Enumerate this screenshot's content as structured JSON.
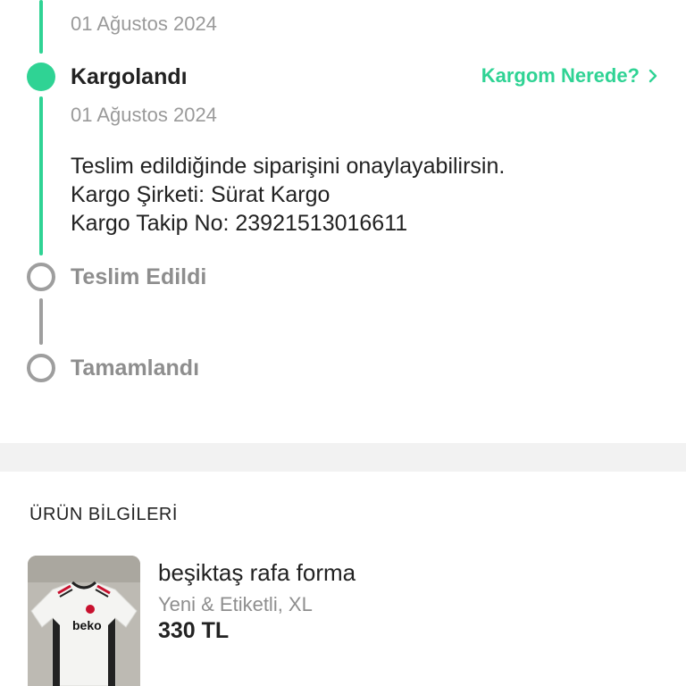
{
  "timeline": {
    "previous_date": "01 Ağustos 2024",
    "steps": [
      {
        "title": "Kargolandı",
        "date": "01 Ağustos 2024",
        "status": "completed",
        "link_label": "Kargom Nerede?",
        "details": [
          "Teslim edildiğinde siparişini onaylayabilirsin.",
          "Kargo Şirketi: Sürat Kargo",
          "Kargo Takip No: 23921513016611"
        ]
      },
      {
        "title": "Teslim Edildi",
        "status": "pending"
      },
      {
        "title": "Tamamlandı",
        "status": "pending"
      }
    ],
    "colors": {
      "active": "#2fd394",
      "inactive": "#9e9e9e"
    }
  },
  "product_section": {
    "title": "ÜRÜN BİLGİLERİ",
    "product": {
      "name": "beşiktaş rafa forma",
      "condition": "Yeni & Etiketli, XL",
      "price": "330 TL",
      "jersey_sponsor": "beko"
    }
  }
}
